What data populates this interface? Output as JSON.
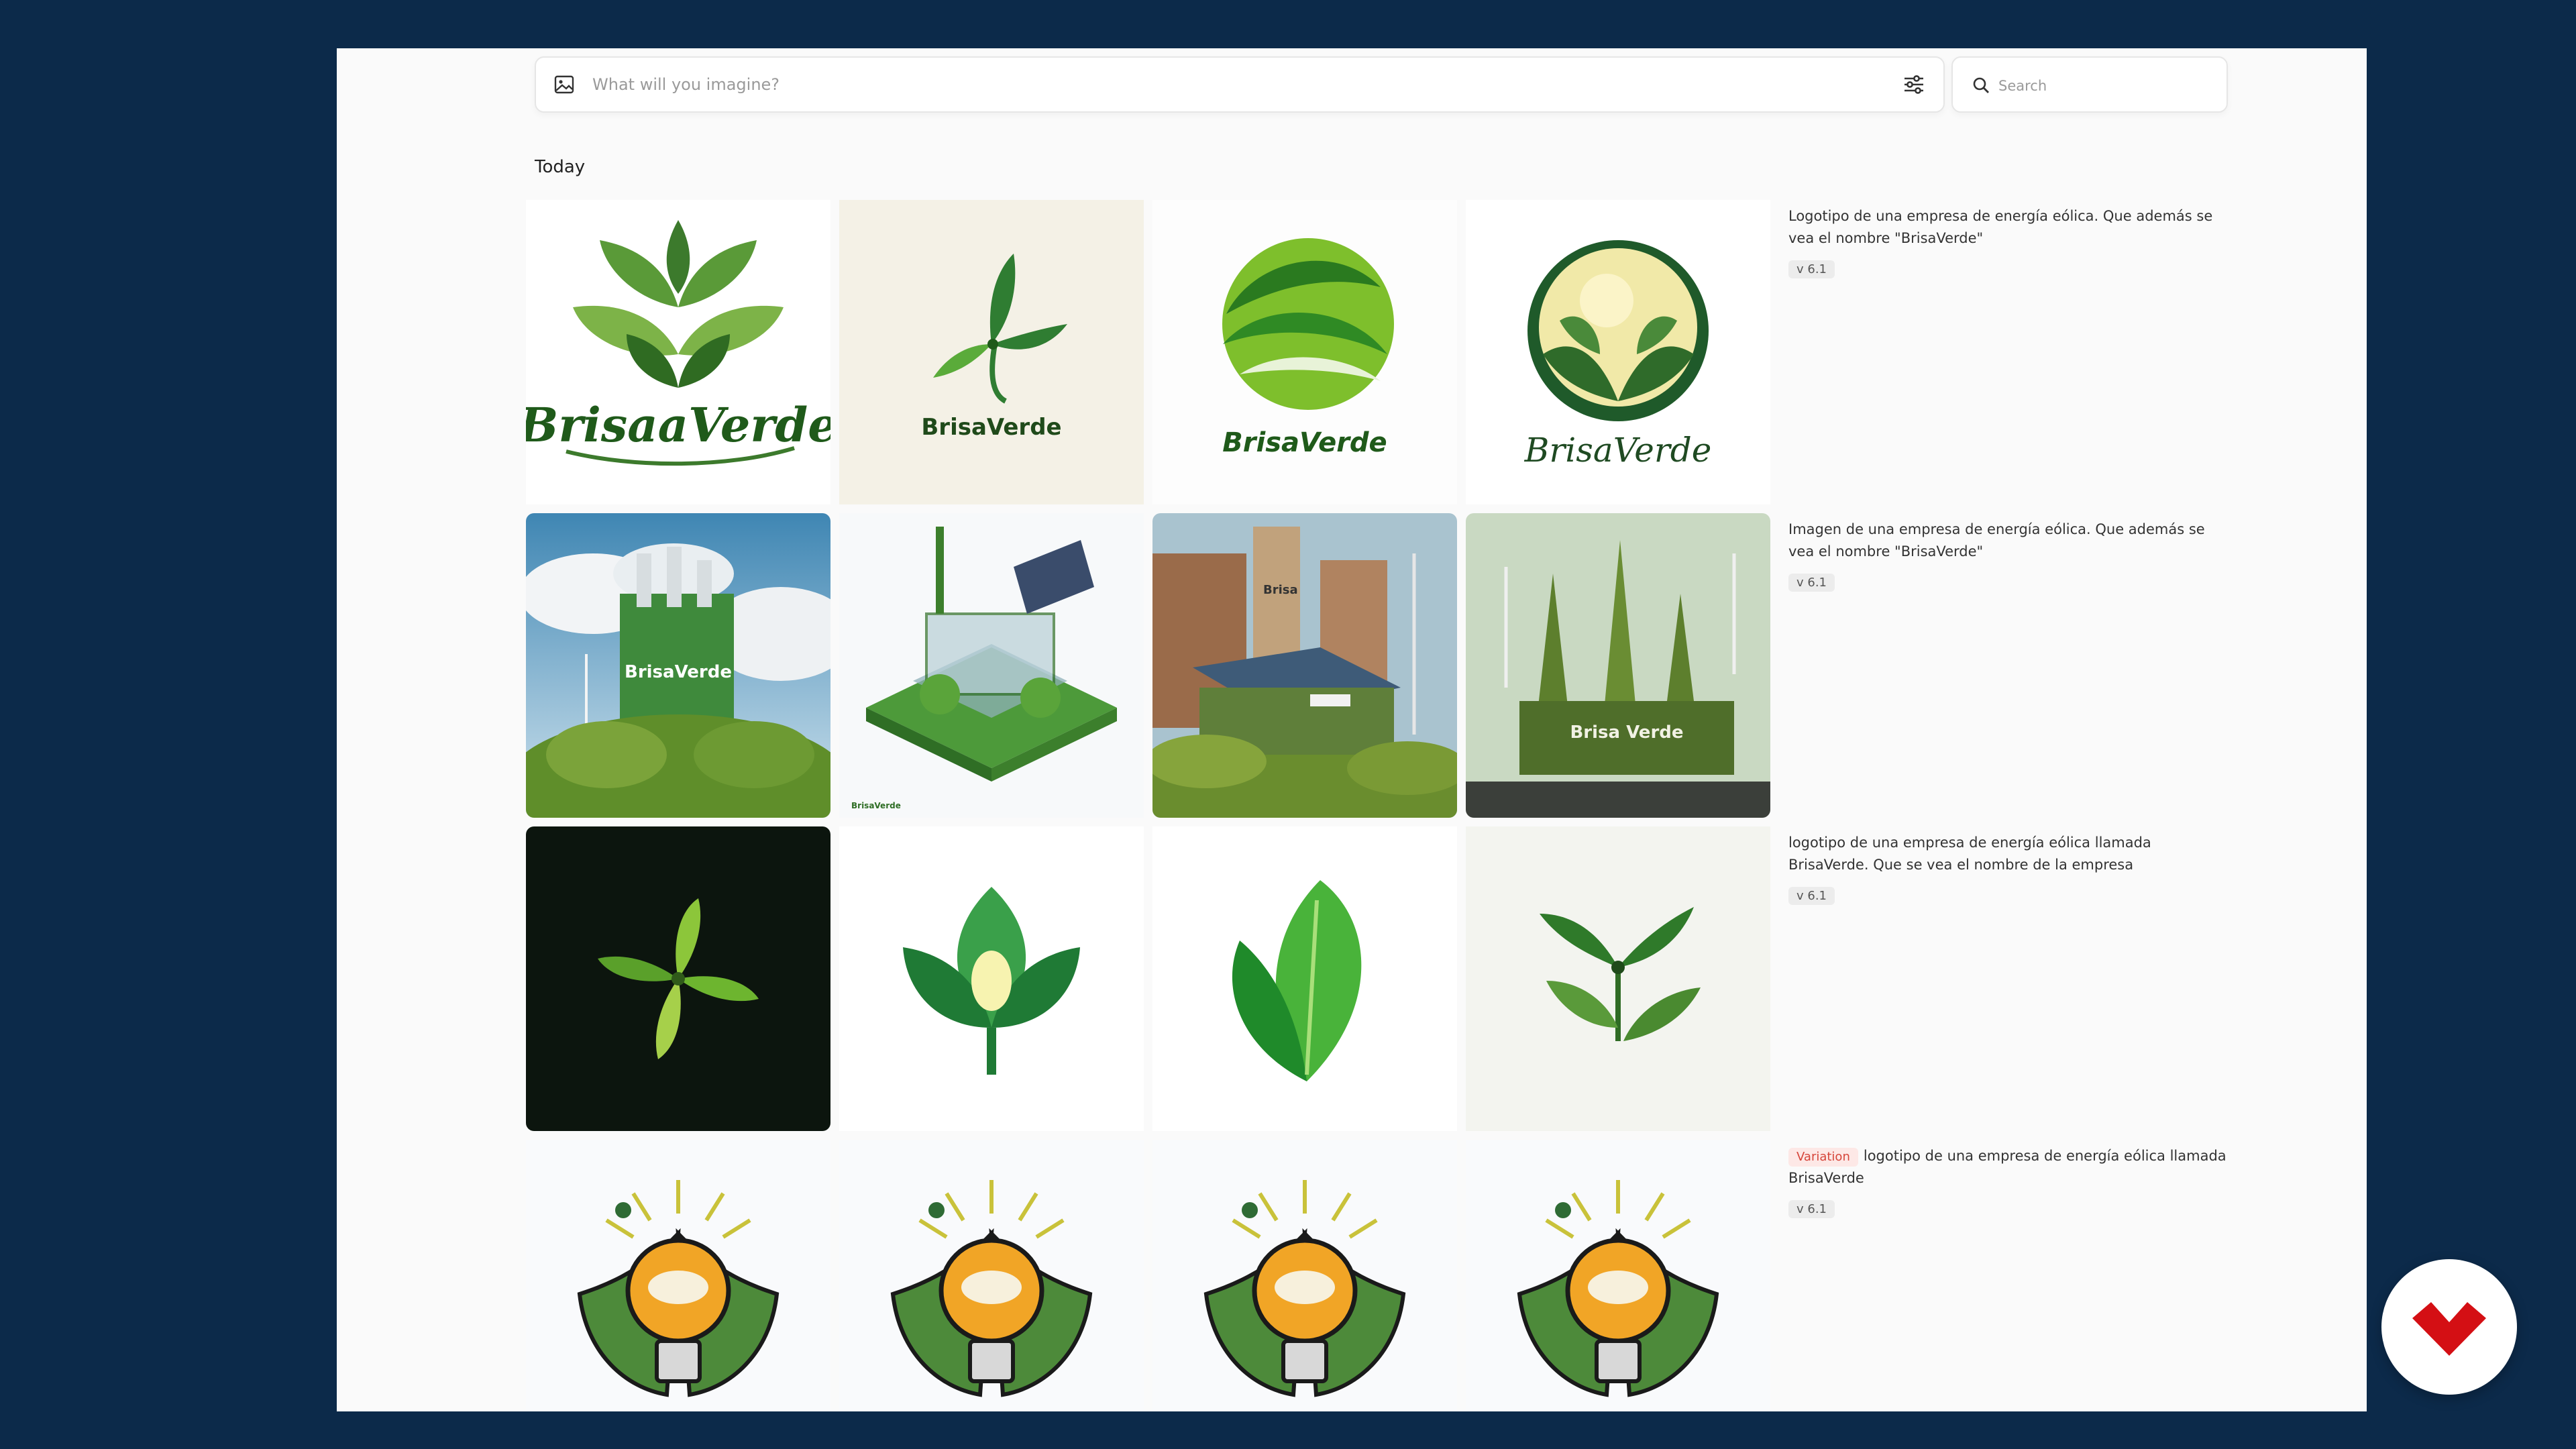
{
  "prompt_bar": {
    "placeholder": "What will you imagine?"
  },
  "search": {
    "placeholder": "Search"
  },
  "section": {
    "label": "Today"
  },
  "rows": [
    {
      "prompt": "Logotipo de una empresa de energía eólica. Que además se vea el nombre \"BrisaVerde\"",
      "version": "v 6.1",
      "tile_texts": [
        "BrisaaVerde",
        "BrisaVerde",
        "BrisaVerde",
        "BrisaVerde"
      ]
    },
    {
      "prompt": "Imagen de una empresa de energía eólica. Que además se vea el nombre \"BrisaVerde\"",
      "version": "v 6.1",
      "tile_texts": [
        "BrisaVerde",
        "BrisaVerde",
        "Brisa",
        "Brisa Verde"
      ]
    },
    {
      "prompt": "logotipo de una empresa de energía eólica llamada BrisaVerde. Que se vea el nombre de la empresa",
      "version": "v 6.1"
    },
    {
      "tag": "Variation",
      "prompt": "logotipo de una empresa de energía eólica llamada BrisaVerde",
      "version": "v 6.1"
    }
  ],
  "colors": {
    "frame_bg": "#0c2a4a",
    "app_bg": "#fafafa",
    "leaf_green": "#2f7d32",
    "bright_green": "#6cc04a",
    "variation_tag_text": "#d6453a",
    "brand_red": "#d40f14"
  },
  "icons": [
    "image-icon",
    "sliders-icon",
    "search-icon",
    "brand-logo-icon"
  ]
}
